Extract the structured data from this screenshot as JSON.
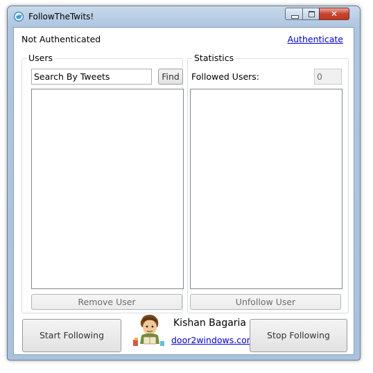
{
  "window": {
    "title": "FollowTheTwits!",
    "close_glyph": "✕"
  },
  "header": {
    "status": "Not Authenticated",
    "auth_link": "Authenticate"
  },
  "users": {
    "group_title": "Users",
    "search_value": "Search By Tweets",
    "find_label": "Find",
    "list_items": [],
    "remove_label": "Remove User"
  },
  "stats": {
    "group_title": "Statistics",
    "followed_label": "Followed Users:",
    "followed_count": "0",
    "list_items": [],
    "unfollow_label": "Unfollow User"
  },
  "footer": {
    "start_label": "Start Following",
    "stop_label": "Stop Following",
    "author_name": "Kishan Bagaria",
    "author_link": "door2windows.com",
    "avatar_icon": "cartoon-reader-avatar"
  },
  "colors": {
    "link": "#0000cc",
    "titlebar": "#b8cde4",
    "close_button": "#c7432d"
  }
}
